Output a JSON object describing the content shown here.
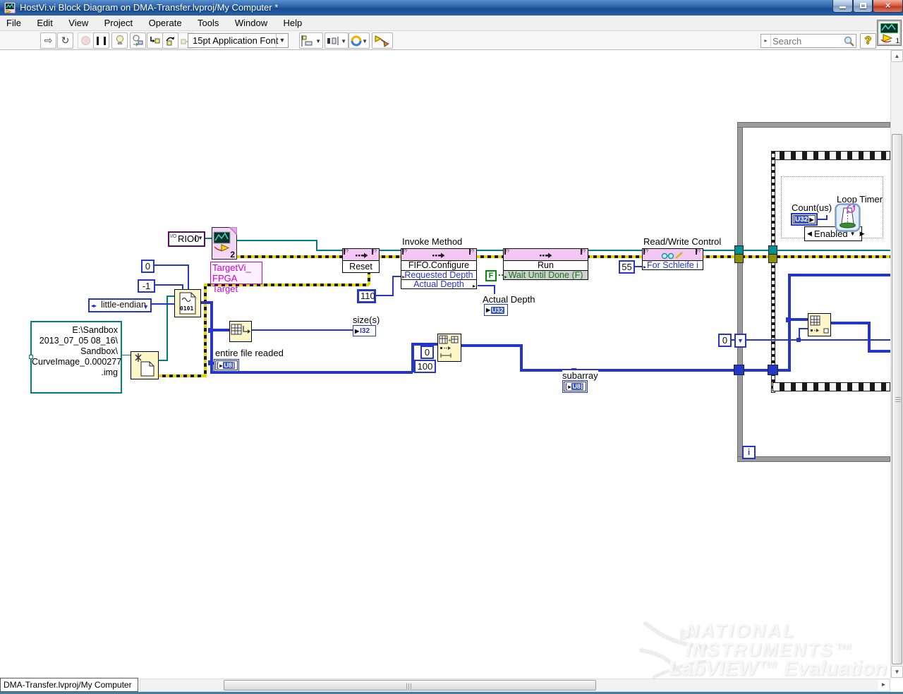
{
  "window": {
    "title": "HostVi.vi Block Diagram on DMA-Transfer.lvproj/My Computer *"
  },
  "menu": {
    "items": [
      "File",
      "Edit",
      "View",
      "Project",
      "Operate",
      "Tools",
      "Window",
      "Help"
    ]
  },
  "toolbar": {
    "font_selector": "15pt Application Font",
    "search_placeholder": "Search",
    "help_glyph": "?",
    "vi_badge": "1"
  },
  "diagram": {
    "rio_constant": "RIO0",
    "rio_io_glyph": "I/O",
    "target_icon_badge": "2",
    "target_vi_label_line1": "TargetVi_",
    "target_vi_label_line2": "FPGA Target",
    "reset_node": {
      "method": "Reset"
    },
    "invoke_method": {
      "title": "Invoke Method",
      "method": "FIFO.Configure",
      "param_in": "Requested Depth",
      "param_out": "Actual Depth"
    },
    "run_node": {
      "method": "Run",
      "param": "Wait Until Done (F)"
    },
    "rw_control": {
      "title": "Read/Write Control",
      "param": "For Schleife i"
    },
    "constants": {
      "zero": "0",
      "minus_one": "-1",
      "endian": "little-endian",
      "depth": "110",
      "f": "F",
      "count55": "55",
      "offset": "0",
      "length": "100",
      "loop_init": "0"
    },
    "file_path_lines": [
      "E:\\Sandbox",
      "2013_07_05 08_16\\",
      "Sandbox\\",
      "CurveImage_0.000277",
      ".img"
    ],
    "file_node_bits": "0101",
    "indicators": {
      "size": {
        "label": "size(s)",
        "type": "I32"
      },
      "entire_file": {
        "label": "entire file readed",
        "type": "U8"
      },
      "subarray": {
        "label": "subarray",
        "type": "U8"
      },
      "actual_depth": {
        "label": "Actual Depth",
        "type": "U32"
      }
    },
    "loop": {
      "iterator": "i",
      "case_selector": "Enabled",
      "loop_timer_label": "Loop Timer",
      "count_label": "Count(us)",
      "count_type": "U32"
    },
    "watermark": {
      "line1": "NATIONAL",
      "line2": "INSTRUMENTS™",
      "line3": "LabVIEW™ Evaluation Software"
    },
    "colors": {
      "wire_blue": "#2636c8",
      "wire_teal": "#007e7e",
      "error_yellow": "#e6d400",
      "node_pink": "#f4c6f4",
      "node_yellow": "#fdf6c9",
      "label_magenta": "#cc00cc",
      "loop_gray": "#9c9c9c",
      "boolean_green": "#0a8a0a",
      "titlebar_blue": "#2a62a8"
    }
  },
  "statusbar": {
    "context": "DMA-Transfer.lvproj/My Computer"
  }
}
